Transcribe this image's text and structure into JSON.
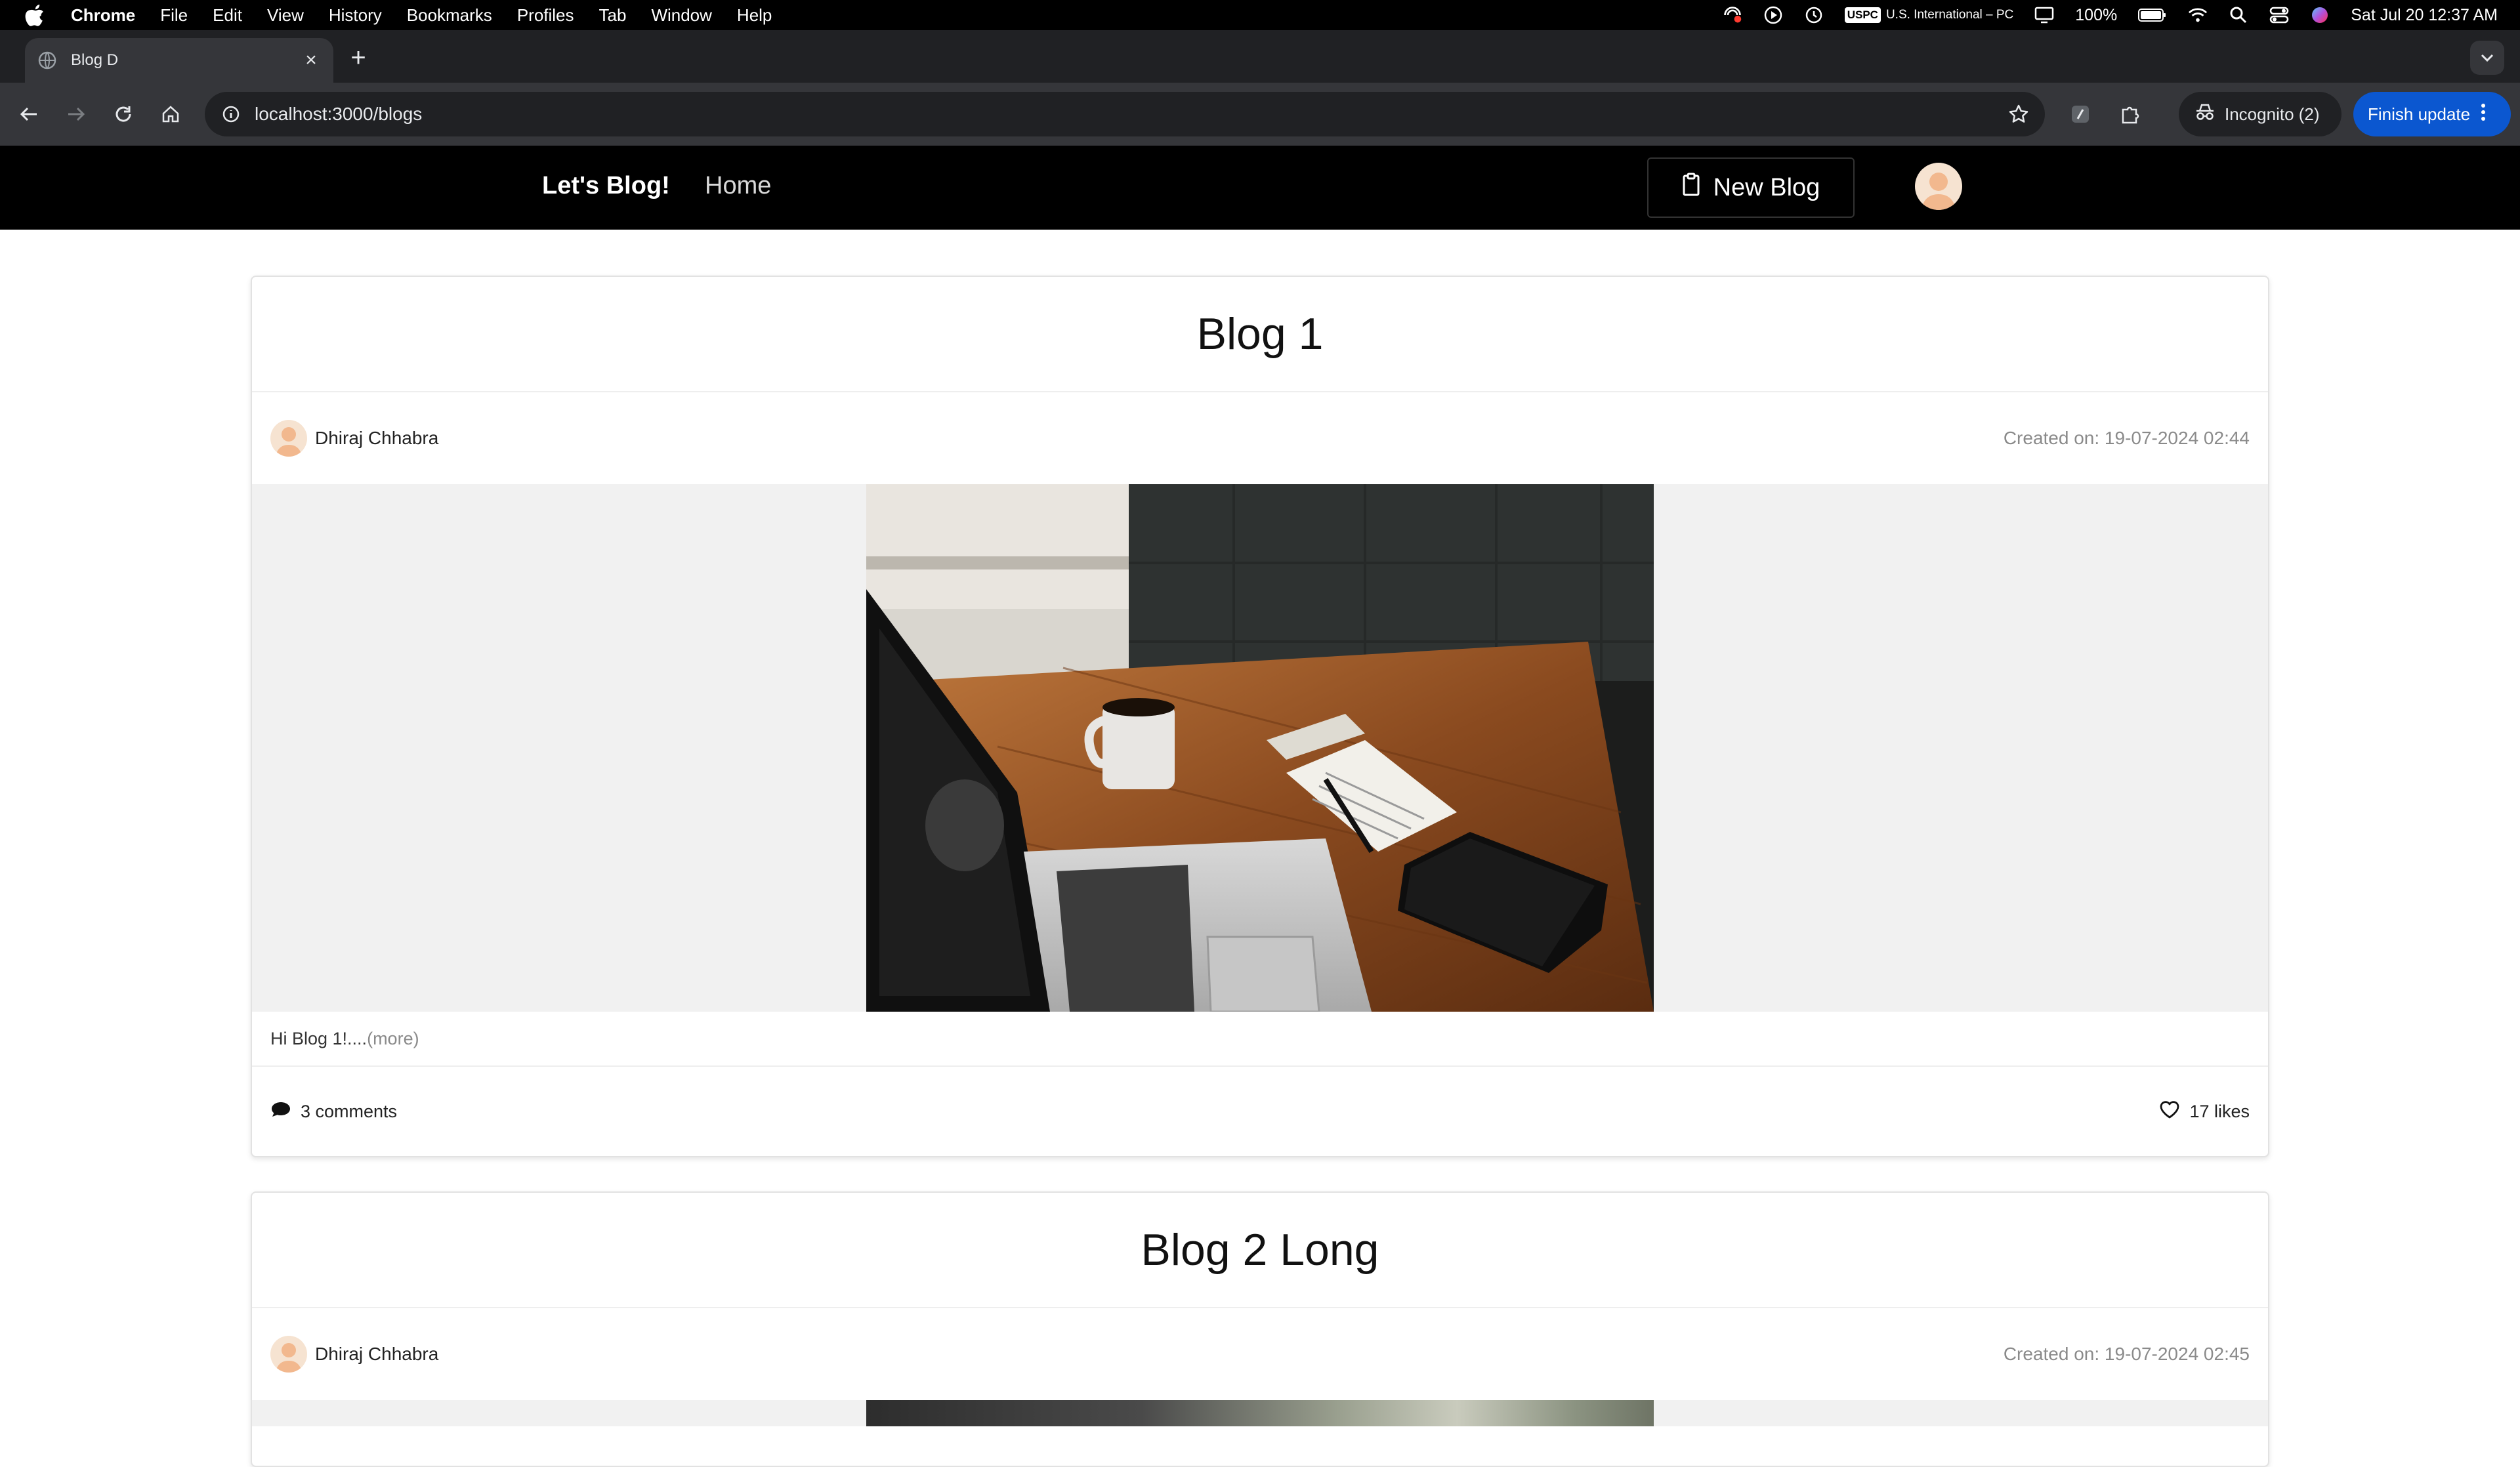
{
  "menubar": {
    "app_name": "Chrome",
    "menus": [
      "File",
      "Edit",
      "View",
      "History",
      "Bookmarks",
      "Profiles",
      "Tab",
      "Window",
      "Help"
    ],
    "keyboard_badge": "USPC",
    "keyboard_label": "U.S. International – PC",
    "battery": "100%",
    "datetime": "Sat Jul 20  12:37 AM"
  },
  "browser": {
    "tab_title": "Blog D",
    "url": "localhost:3000/blogs",
    "incognito_label": "Incognito (2)",
    "update_label": "Finish update"
  },
  "app": {
    "brand": "Let's Blog!",
    "home_label": "Home",
    "new_blog_label": "New Blog"
  },
  "blogs": [
    {
      "title": "Blog 1",
      "author": "Dhiraj Chhabra",
      "created": "Created on: 19-07-2024 02:44",
      "excerpt": "Hi Blog 1!....",
      "more_label": "(more)",
      "comments": "3 comments",
      "likes": "17 likes"
    },
    {
      "title": "Blog 2 Long",
      "author": "Dhiraj Chhabra",
      "created": "Created on: 19-07-2024 02:45"
    }
  ],
  "colors": {
    "accent_blue": "#0b57d0",
    "navbar": "#000000",
    "muted_text": "#8a8a8a"
  }
}
